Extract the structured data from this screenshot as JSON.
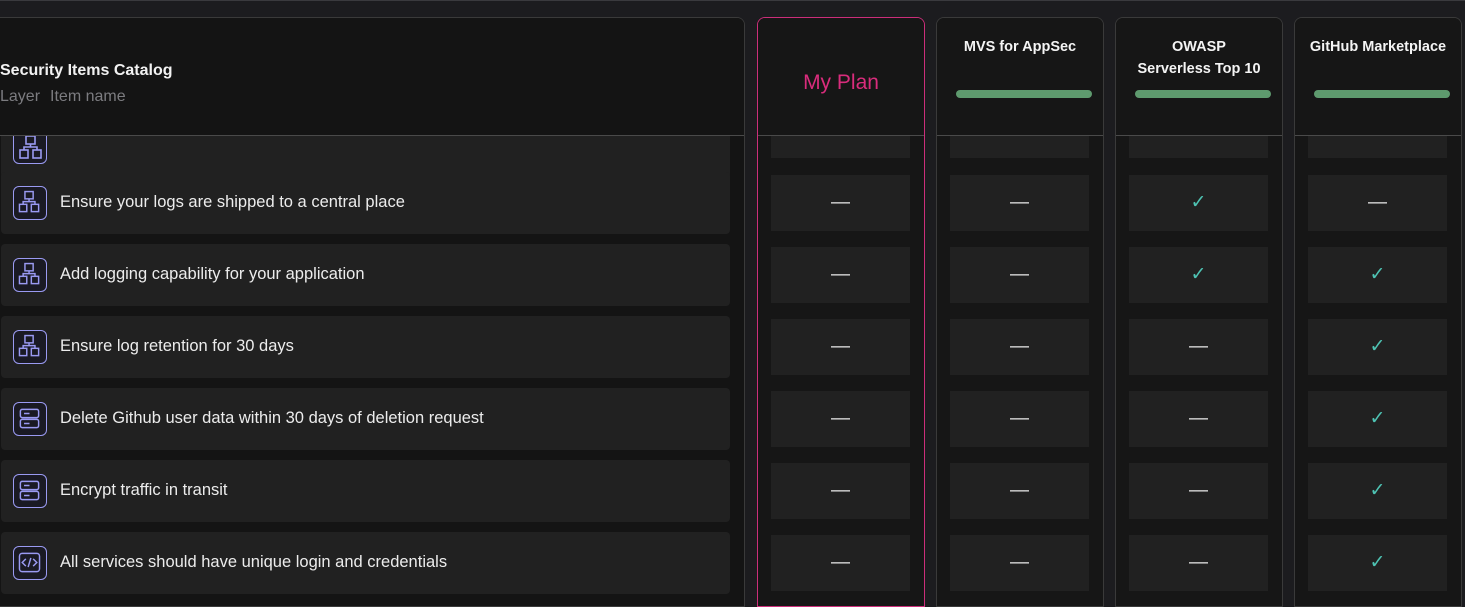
{
  "catalog": {
    "title": "Security Items Catalog",
    "sub_layer": "Layer",
    "sub_item": "Item name"
  },
  "rows": [
    {
      "label": "Ensure your logs are shipped to a central place",
      "icon": "network-nodes-icon"
    },
    {
      "label": "Add logging capability for your application",
      "icon": "network-nodes-icon"
    },
    {
      "label": "Ensure log retention for 30 days",
      "icon": "network-nodes-icon"
    },
    {
      "label": "Delete Github user data within 30 days of deletion request",
      "icon": "server-icon"
    },
    {
      "label": "Encrypt traffic in transit",
      "icon": "server-icon"
    },
    {
      "label": "All services should have unique login and credentials",
      "icon": "code-icon"
    }
  ],
  "columns": [
    {
      "name": "My Plan",
      "bar": false,
      "marks": [
        "—",
        "—",
        "—",
        "—",
        "—",
        "—"
      ]
    },
    {
      "name": "MVS for AppSec",
      "bar": true,
      "marks": [
        "—",
        "—",
        "—",
        "—",
        "—",
        "—"
      ]
    },
    {
      "name": "OWASP Serverless Top 10",
      "bar": true,
      "marks": [
        "✓",
        "✓",
        "—",
        "—",
        "—",
        "—"
      ]
    },
    {
      "name": "GitHub Marketplace",
      "bar": true,
      "marks": [
        "—",
        "✓",
        "✓",
        "✓",
        "✓",
        "✓"
      ]
    }
  ],
  "colors": {
    "accent": "#d92c7c",
    "check": "#4ec3b3",
    "progress": "#5e9a6e",
    "icon": "#9a9af2"
  }
}
